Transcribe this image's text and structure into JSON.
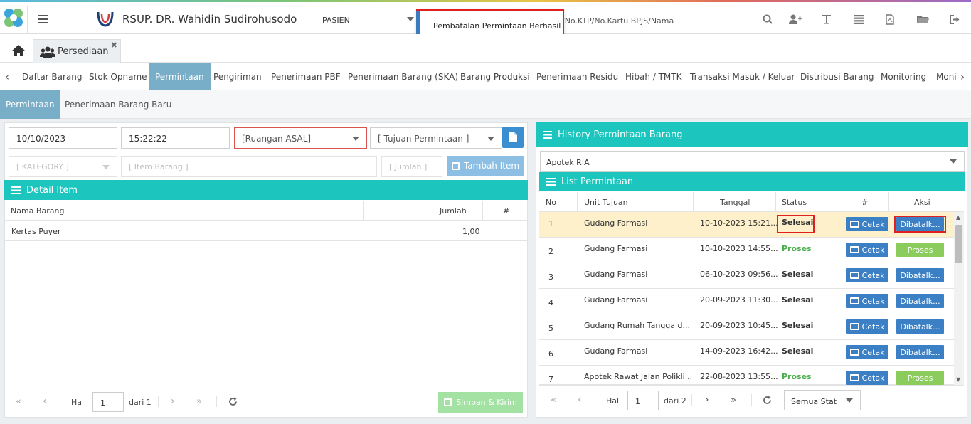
{
  "header": {
    "hospital_name": "RSUP. DR. Wahidin Sudirohusodo",
    "patient_select": "PASIEN",
    "search_placeholder": "/No.KTP/No.Kartu BPJS/Nama",
    "toast_message": "Pembatalan Permintaan Berhasil",
    "accent_color": "#1cc6be"
  },
  "module_tab": {
    "label": "Persediaan",
    "close": "✖"
  },
  "nav": {
    "items": [
      "Daftar Barang",
      "Stok Opname",
      "Permintaan",
      "Pengiriman",
      "Penerimaan PBF",
      "Penerimaan Barang (SKA)",
      "Barang Produksi",
      "Penerimaan Residu",
      "Hibah / TMTK",
      "Transaksi Masuk / Keluar",
      "Distribusi Barang",
      "Monitoring",
      "Moni"
    ],
    "active": "Permintaan"
  },
  "subnav": {
    "items": [
      "Permintaan",
      "Penerimaan Barang Baru"
    ],
    "active": "Permintaan"
  },
  "form": {
    "date": "10/10/2023",
    "time": "15:22:22",
    "ruangan_asal": "[Ruangan ASAL]",
    "tujuan": "[ Tujuan Permintaan ]",
    "category": "[ KATEGORY ]",
    "item_barang": "[ Item Barang ]",
    "jumlah": "[ Jumlah ]",
    "tambah_label": "Tambah Item"
  },
  "detail": {
    "title": "Detail Item",
    "columns": [
      "Nama Barang",
      "Jumlah",
      "#"
    ],
    "rows": [
      {
        "nama": "Kertas Puyer",
        "jumlah": "1,00"
      }
    ]
  },
  "left_pager": {
    "hal_label": "Hal",
    "page": "1",
    "of_label": "dari 1",
    "save_label": "Simpan & Kirim"
  },
  "history": {
    "title": "History Permintaan Barang",
    "apotek": "Apotek RIA",
    "list_title": "List Permintaan",
    "columns": [
      "No",
      "Unit Tujuan",
      "Tanggal",
      "Status",
      "#",
      "Aksi"
    ],
    "cetak_label": "Cetak",
    "rows": [
      {
        "no": "1",
        "unit": "Gudang Farmasi",
        "tanggal": "10-10-2023 15:21...",
        "status": "Selesai",
        "aksi": "Dibatalk..."
      },
      {
        "no": "2",
        "unit": "Gudang Farmasi",
        "tanggal": "10-10-2023 14:55...",
        "status": "Proses",
        "aksi": "Proses"
      },
      {
        "no": "3",
        "unit": "Gudang Farmasi",
        "tanggal": "06-10-2023 09:56...",
        "status": "Selesai",
        "aksi": "Dibatalk..."
      },
      {
        "no": "4",
        "unit": "Gudang Farmasi",
        "tanggal": "20-09-2023 11:30...",
        "status": "Selesai",
        "aksi": "Dibatalk..."
      },
      {
        "no": "5",
        "unit": "Gudang Rumah Tangga d...",
        "tanggal": "20-09-2023 10:45...",
        "status": "Selesai",
        "aksi": "Dibatalk..."
      },
      {
        "no": "6",
        "unit": "Gudang Farmasi",
        "tanggal": "14-09-2023 16:42...",
        "status": "Selesai",
        "aksi": "Dibatalk..."
      },
      {
        "no": "7",
        "unit": "Apotek Rawat Jalan Polikli...",
        "tanggal": "22-08-2023 13:55...",
        "status": "Proses",
        "aksi": "Proses"
      }
    ]
  },
  "right_pager": {
    "hal_label": "Hal",
    "page": "1",
    "of_label": "dari 2",
    "status_filter": "Semua Stat"
  }
}
